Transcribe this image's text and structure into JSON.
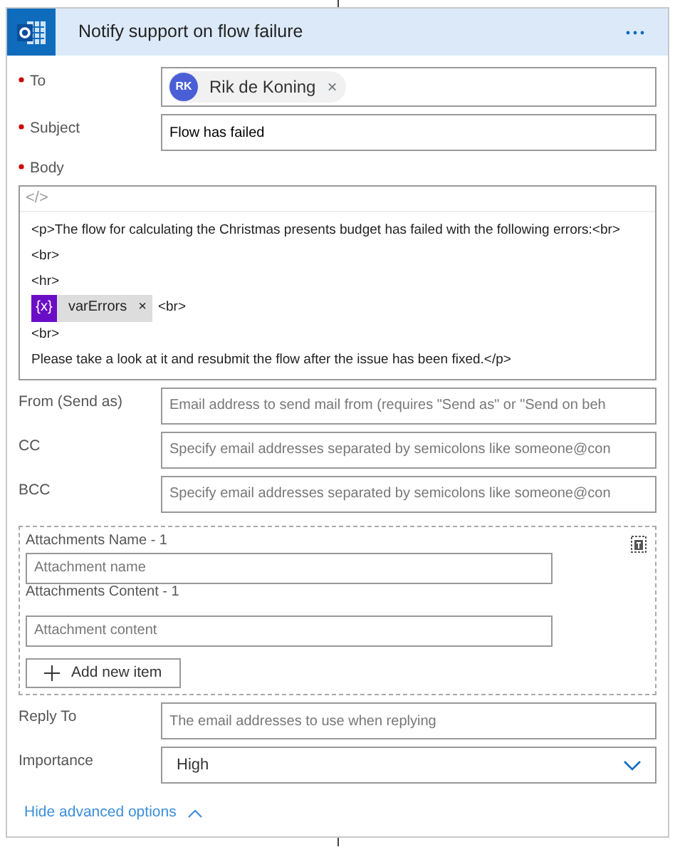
{
  "header": {
    "title": "Notify support on flow failure"
  },
  "fields": [
    {
      "kind": "recipients",
      "label": "To",
      "required": true,
      "chips": [
        {
          "initials": "RK",
          "name": "Rik de Koning",
          "remove": "×"
        }
      ]
    },
    {
      "kind": "text",
      "label": "Subject",
      "required": true,
      "value": "Flow has failed"
    },
    {
      "kind": "body",
      "label": "Body",
      "required": true,
      "code_toggle": "</>",
      "lines": [
        {
          "text": "<p>The flow for calculating the Christmas presents budget has failed with the following errors:<br>"
        },
        {
          "text": "<br>"
        },
        {
          "text": "<hr>"
        },
        {
          "token": {
            "icon": "{x}",
            "label": "varErrors",
            "remove": "×"
          },
          "text": "<br>"
        },
        {
          "text": "<br>"
        },
        {
          "text": "Please take a look at it and resubmit the flow after the issue has been fixed.</p>"
        }
      ]
    },
    {
      "kind": "text",
      "label": "From (Send as)",
      "required": false,
      "placeholder": "Email address to send mail from (requires \"Send as\" or \"Send on beh"
    },
    {
      "kind": "text",
      "label": "CC",
      "required": false,
      "placeholder": "Specify email addresses separated by semicolons like someone@con"
    },
    {
      "kind": "text",
      "label": "BCC",
      "required": false,
      "placeholder": "Specify email addresses separated by semicolons like someone@con"
    },
    {
      "kind": "attachments",
      "items": [
        {
          "name_label": "Attachments Name - 1",
          "name_placeholder": "Attachment name",
          "content_label": "Attachments Content - 1",
          "content_placeholder": "Attachment content"
        }
      ],
      "add_button": "Add new item"
    },
    {
      "kind": "text",
      "label": "Reply To",
      "required": false,
      "placeholder": "The email addresses to use when replying"
    },
    {
      "kind": "select",
      "label": "Importance",
      "required": false,
      "value": "High"
    }
  ],
  "advanced_link": "Hide advanced options"
}
